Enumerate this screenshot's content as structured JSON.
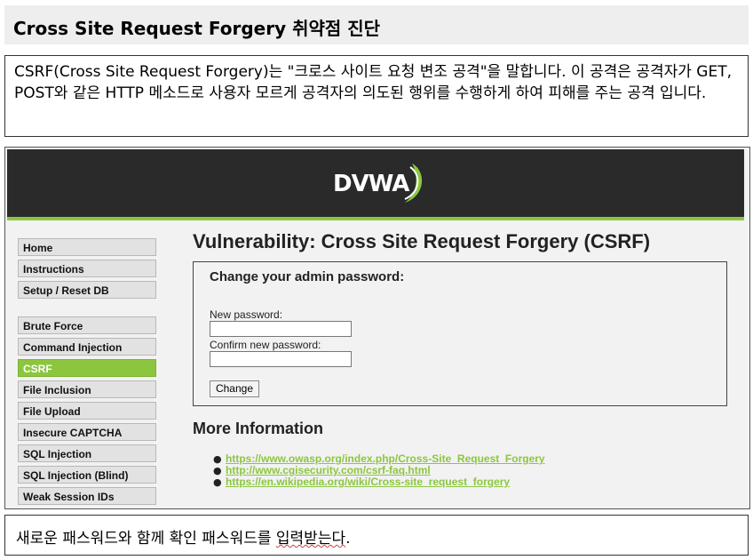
{
  "title": "Cross Site Request Forgery 취약점 진단",
  "description": "CSRF(Cross Site Request Forgery)는 \"크로스 사이트 요청 변조 공격\"을 말합니다. 이 공격은 공격자가 GET, POST와 같은 HTTP 메소드로 사용자 모르게 공격자의 의도된 행위를 수행하게 하여 피해를 주는 공격 입니다.",
  "dvwa": {
    "logo_text": "DVWA",
    "accent_color": "#8cc63f",
    "menu": {
      "items": [
        {
          "label": "Home"
        },
        {
          "label": "Instructions"
        },
        {
          "label": "Setup / Reset DB"
        },
        {
          "label": "Brute Force"
        },
        {
          "label": "Command Injection"
        },
        {
          "label": "CSRF",
          "selected": true
        },
        {
          "label": "File Inclusion"
        },
        {
          "label": "File Upload"
        },
        {
          "label": "Insecure CAPTCHA"
        },
        {
          "label": "SQL Injection"
        },
        {
          "label": "SQL Injection (Blind)"
        },
        {
          "label": "Weak Session IDs"
        }
      ]
    },
    "page_title": "Vulnerability: Cross Site Request Forgery (CSRF)",
    "form": {
      "heading": "Change your admin password:",
      "new_password_label": "New password:",
      "new_password_value": "",
      "confirm_password_label": "Confirm new password:",
      "confirm_password_value": "",
      "submit_label": "Change"
    },
    "more_info": {
      "title": "More Information",
      "links": [
        "https://www.owasp.org/index.php/Cross-Site_Request_Forgery",
        "http://www.cgisecurity.com/csrf-faq.html",
        "https://en.wikipedia.org/wiki/Cross-site_request_forgery"
      ]
    }
  },
  "bottom_note": {
    "prefix": "새로운 패스워드와 함께 확인 패스워드를 ",
    "marked": "입력받는다",
    "suffix": "."
  }
}
